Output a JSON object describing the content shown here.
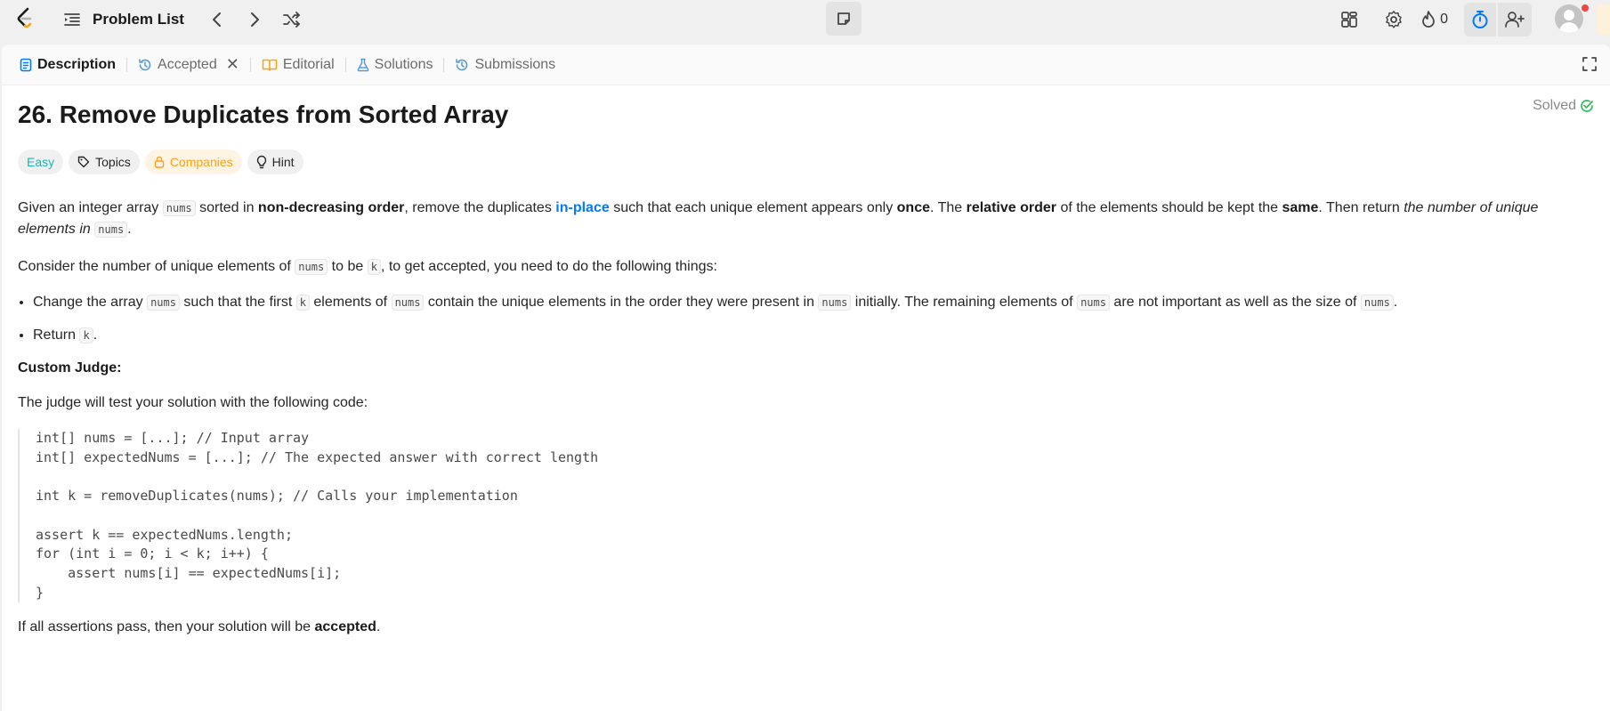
{
  "nav": {
    "title": "Problem List",
    "streak_count": "0"
  },
  "tabs": [
    {
      "label": "Description"
    },
    {
      "label": "Accepted"
    },
    {
      "label": "Editorial"
    },
    {
      "label": "Solutions"
    },
    {
      "label": "Submissions"
    }
  ],
  "problem": {
    "title": "26. Remove Duplicates from Sorted Array",
    "status": "Solved",
    "tags": {
      "difficulty": "Easy",
      "topics": "Topics",
      "companies": "Companies",
      "hint": "Hint"
    },
    "p1": {
      "t1": "Given an integer array ",
      "c1": "nums",
      "t2": " sorted in ",
      "b1": "non-decreasing order",
      "t3": ", remove the duplicates ",
      "link": "in-place",
      "t4": " such that each unique element appears only ",
      "b2": "once",
      "t5": ". The ",
      "b3": "relative order",
      "t6": " of the elements should be kept the ",
      "b4": "same",
      "t7": ". Then return ",
      "i1": "the number of unique elements in ",
      "c2": "nums",
      "t8": "."
    },
    "p2": {
      "t1": "Consider the number of unique elements of ",
      "c1": "nums",
      "t2": " to be ",
      "c2": "k",
      "t3": ", to get accepted, you need to do the following things:"
    },
    "bullet1": {
      "t1": "Change the array ",
      "c1": "nums",
      "t2": " such that the first ",
      "c2": "k",
      "t3": " elements of ",
      "c3": "nums",
      "t4": " contain the unique elements in the order they were present in ",
      "c4": "nums",
      "t5": " initially. The remaining elements of ",
      "c5": "nums",
      "t6": " are not important as well as the size of ",
      "c6": "nums",
      "t7": "."
    },
    "bullet2": {
      "t1": "Return ",
      "c1": "k",
      "t2": "."
    },
    "custom_judge": "Custom Judge:",
    "judge_intro": "The judge will test your solution with the following code:",
    "code": "int[] nums = [...]; // Input array\nint[] expectedNums = [...]; // The expected answer with correct length\n\nint k = removeDuplicates(nums); // Calls your implementation\n\nassert k == expectedNums.length;\nfor (int i = 0; i < k; i++) {\n    assert nums[i] == expectedNums[i];\n}",
    "final": {
      "t1": "If all assertions pass, then your solution will be ",
      "b1": "accepted",
      "t2": "."
    }
  },
  "colors": {
    "accent_blue": "#007aff",
    "easy": "#1cb8b8",
    "companies": "#ffa116",
    "solved_check": "#2cbb5d",
    "logo_orange": "#ffa116"
  },
  "icons": {
    "logo": "leetcode-logo",
    "list": "list-icon",
    "prev": "chevron-left-icon",
    "next": "chevron-right-icon",
    "shuffle": "shuffle-icon",
    "note": "note-icon",
    "layout": "layout-icon",
    "settings": "gear-icon",
    "streak": "fire-icon",
    "timer": "stopwatch-icon",
    "add_user": "add-user-icon",
    "avatar": "avatar",
    "expand": "expand-icon"
  }
}
